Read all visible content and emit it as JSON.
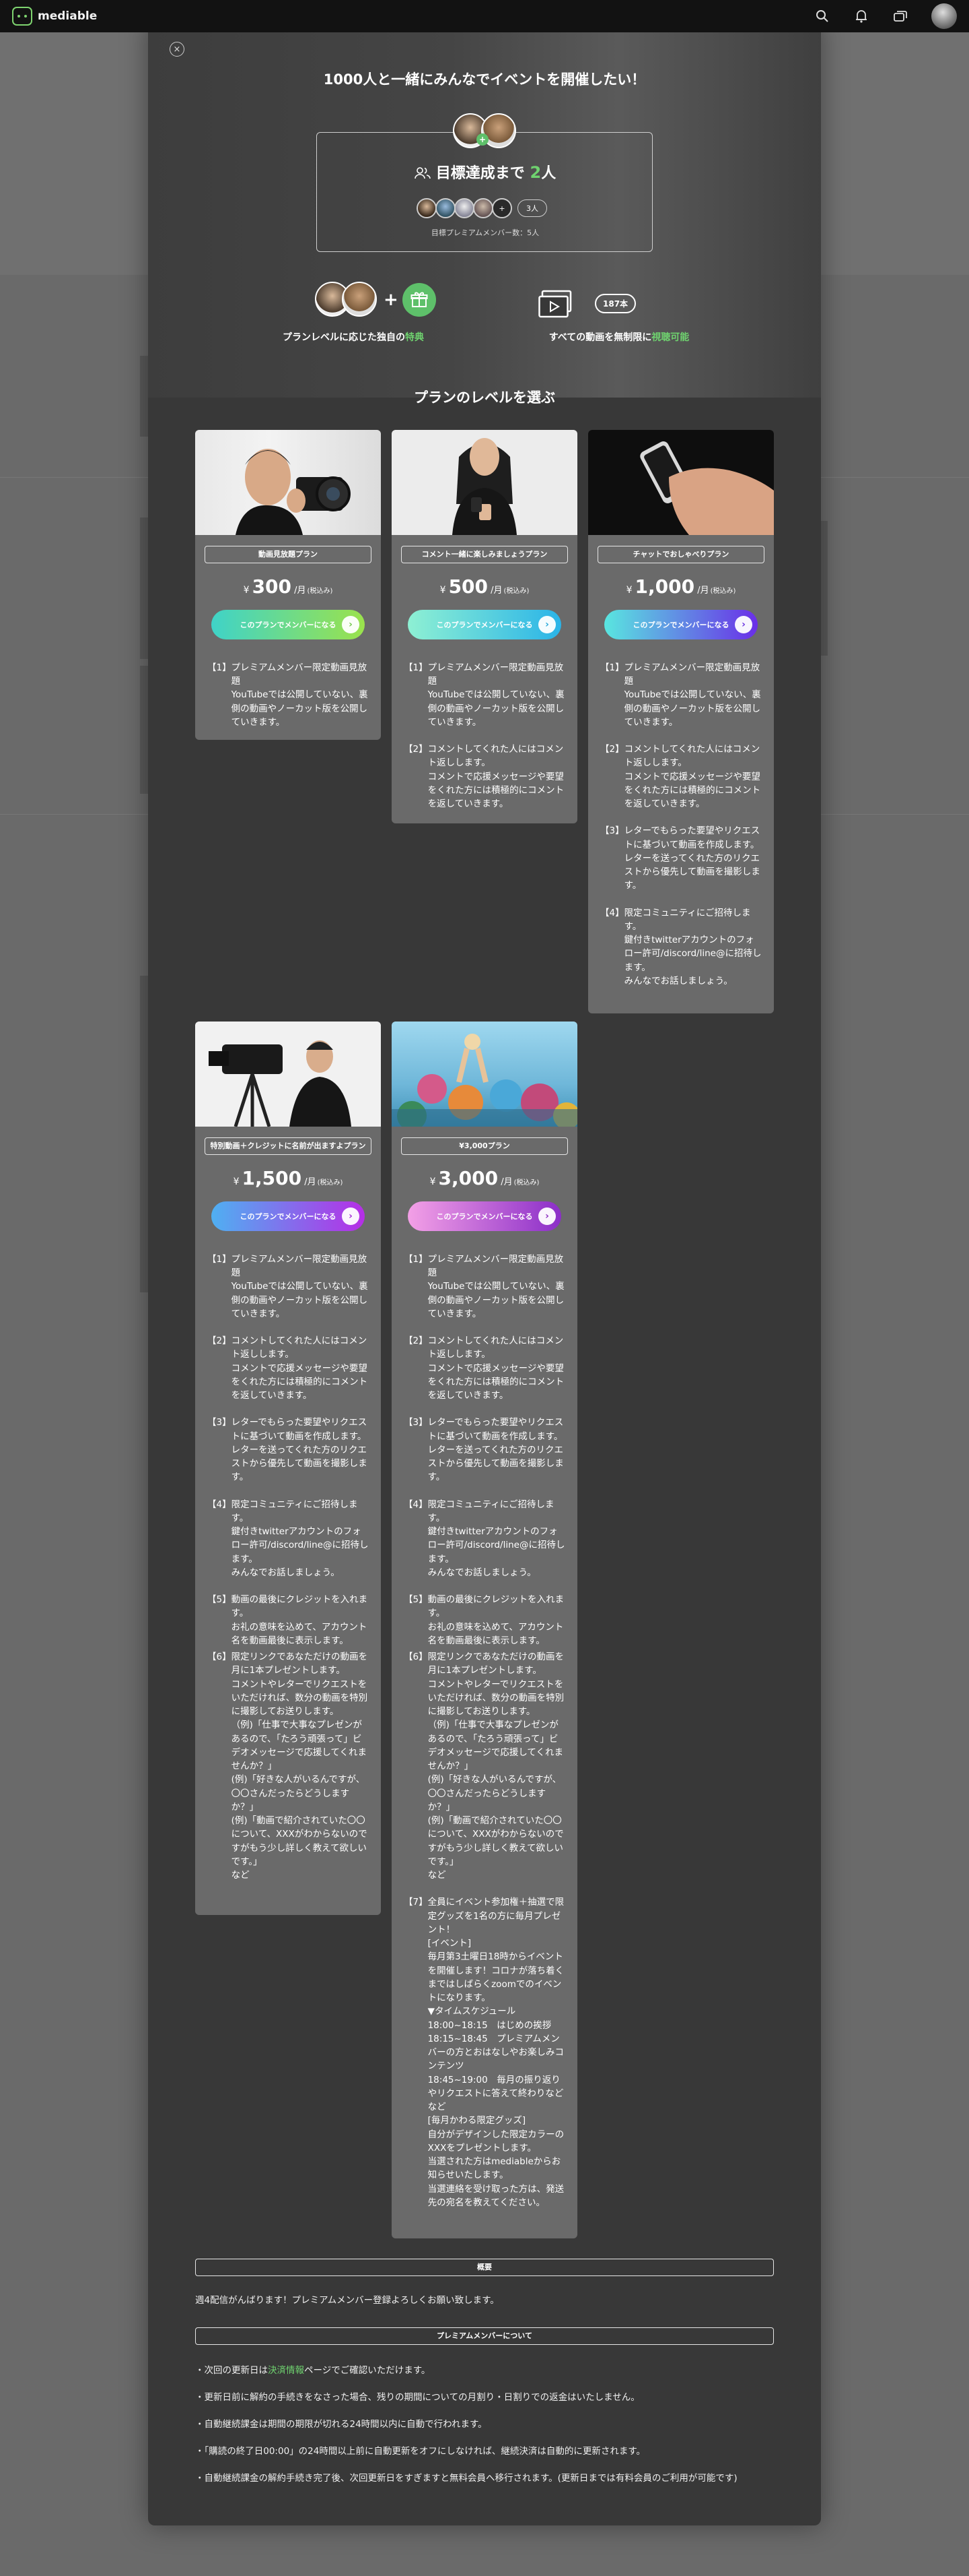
{
  "header": {
    "logo_text": "mediable",
    "icons": [
      "search-icon",
      "bell-icon",
      "cards-icon",
      "avatar"
    ]
  },
  "modal": {
    "close": "×",
    "title": "1000人と一緒にみんなでイベントを開催したい！",
    "goal": {
      "prefix": "目標達成まで",
      "remaining": "2",
      "suffix": "人",
      "member_count_badge": "3人",
      "note": "目標プレミアムメンバー数：5人"
    },
    "benefits": {
      "plan_text_pre": "プランレベルに応じた独自の",
      "plan_text_hl": "特典",
      "video_text_pre": "すべての動画を無制限に",
      "video_text_hl": "視聴可能",
      "video_count": "187本"
    },
    "section_title": "プランのレベルを選ぶ",
    "plans": [
      {
        "name": "動画見放題プラン",
        "currency": "¥",
        "price": "300",
        "unit": "/月",
        "tax": "(税込み)",
        "button": "このプランでメンバーになる",
        "items": [
          {
            "no": "【1】",
            "text": "プレミアムメンバー限定動画見放題\nYouTubeでは公開していない、裏側の動画やノーカット版を公開していきます。"
          }
        ]
      },
      {
        "name": "コメント一緒に楽しみましょうプラン",
        "currency": "¥",
        "price": "500",
        "unit": "/月",
        "tax": "(税込み)",
        "button": "このプランでメンバーになる",
        "items": [
          {
            "no": "【1】",
            "text": "プレミアムメンバー限定動画見放題\nYouTubeでは公開していない、裏側の動画やノーカット版を公開していきます。"
          },
          {
            "no": "【2】",
            "text": "コメントしてくれた人にはコメント返しします。\nコメントで応援メッセージや要望をくれた方には積極的にコメントを返していきます。"
          }
        ]
      },
      {
        "name": "チャットでおしゃべりプラン",
        "currency": "¥",
        "price": "1,000",
        "unit": "/月",
        "tax": "(税込み)",
        "button": "このプランでメンバーになる",
        "items": [
          {
            "no": "【1】",
            "text": "プレミアムメンバー限定動画見放題\nYouTubeでは公開していない、裏側の動画やノーカット版を公開していきます。"
          },
          {
            "no": "【2】",
            "text": "コメントしてくれた人にはコメント返しします。\nコメントで応援メッセージや要望をくれた方には積極的にコメントを返していきます。"
          },
          {
            "no": "【3】",
            "text": "レターでもらった要望やリクエストに基づいて動画を作成します。\nレターを送ってくれた方のリクエストから優先して動画を撮影します。"
          },
          {
            "no": "【4】",
            "text": "限定コミュニティにご招待します。\n鍵付きtwitterアカウントのフォロー許可/discord/line@に招待します。\nみんなでお話しましょう。"
          }
        ]
      },
      {
        "name": "特別動画＋クレジットに名前が出ますよプラン",
        "currency": "¥",
        "price": "1,500",
        "unit": "/月",
        "tax": "(税込み)",
        "button": "このプランでメンバーになる",
        "items": [
          {
            "no": "【1】",
            "text": "プレミアムメンバー限定動画見放題\nYouTubeでは公開していない、裏側の動画やノーカット版を公開していきます。"
          },
          {
            "no": "【2】",
            "text": "コメントしてくれた人にはコメント返しします。\nコメントで応援メッセージや要望をくれた方には積極的にコメントを返していきます。"
          },
          {
            "no": "【3】",
            "text": "レターでもらった要望やリクエストに基づいて動画を作成します。\nレターを送ってくれた方のリクエストから優先して動画を撮影します。"
          },
          {
            "no": "【4】",
            "text": "限定コミュニティにご招待します。\n鍵付きtwitterアカウントのフォロー許可/discord/line@に招待します。\nみんなでお話しましょう。"
          },
          {
            "no": "【5】",
            "text": "動画の最後にクレジットを入れます。\nお礼の意味を込めて、アカウント名を動画最後に表示します。"
          },
          {
            "no": "【6】",
            "text": "限定リンクであなただけの動画を月に1本プレゼントします。\nコメントやレターでリクエストをいただければ、数分の動画を特別に撮影してお送りします。\n（例)「仕事で大事なプレゼンがあるので、「たろう頑張って」ビデオメッセージで応援してくれませんか？」\n(例)「好きな人がいるんですが、〇〇さんだったらどうしますか？」\n(例)「動画で紹介されていた〇〇について、XXXがわからないのですがもう少し詳しく教えて欲しいです。」\nなど"
          }
        ]
      },
      {
        "name": "¥3,000プラン",
        "currency": "¥",
        "price": "3,000",
        "unit": "/月",
        "tax": "(税込み)",
        "button": "このプランでメンバーになる",
        "items": [
          {
            "no": "【1】",
            "text": "プレミアムメンバー限定動画見放題\nYouTubeでは公開していない、裏側の動画やノーカット版を公開していきます。"
          },
          {
            "no": "【2】",
            "text": "コメントしてくれた人にはコメント返しします。\nコメントで応援メッセージや要望をくれた方には積極的にコメントを返していきます。"
          },
          {
            "no": "【3】",
            "text": "レターでもらった要望やリクエストに基づいて動画を作成します。\nレターを送ってくれた方のリクエストから優先して動画を撮影します。"
          },
          {
            "no": "【4】",
            "text": "限定コミュニティにご招待します。\n鍵付きtwitterアカウントのフォロー許可/discord/line@に招待します。\nみんなでお話しましょう。"
          },
          {
            "no": "【5】",
            "text": "動画の最後にクレジットを入れます。\nお礼の意味を込めて、アカウント名を動画最後に表示します。"
          },
          {
            "no": "【6】",
            "text": "限定リンクであなただけの動画を月に1本プレゼントします。\nコメントやレターでリクエストをいただければ、数分の動画を特別に撮影してお送りします。\n（例)「仕事で大事なプレゼンがあるので、「たろう頑張って」ビデオメッセージで応援してくれませんか？」\n(例)「好きな人がいるんですが、〇〇さんだったらどうしますか？」\n(例)「動画で紹介されていた〇〇について、XXXがわからないのですがもう少し詳しく教えて欲しいです。」\nなど"
          },
          {
            "no": "【7】",
            "text": "全員にイベント参加権＋抽選で限定グッズを1名の方に毎月プレゼント！\n[イベント]\n毎月第3土曜日18時からイベントを開催します！コロナが落ち着くまではしばらくzoomでのイベントになります。\n▼タイムスケジュール\n18:00~18:15　はじめの挨拶\n18:15~18:45　プレミアムメンバーの方とおはなしやお楽しみコンテンツ\n18:45~19:00　毎月の振り返りやリクエストに答えて終わりなどなど\n[毎月かわる限定グッズ]\n自分がデザインした限定カラーのXXXをプレゼントします。\n当選された方はmediableからお知らせいたします。\n当選連絡を受け取った方は、発送先の宛名を教えてください。"
          }
        ]
      }
    ],
    "summary": {
      "label": "概要",
      "text": "週4配信がんばります！プレミアムメンバー登録よろしくお願い致します。"
    },
    "about": {
      "label": "プレミアムメンバーについて",
      "line1_pre": "・次回の更新日は",
      "line1_link": "決済情報",
      "line1_post": "ページでご確認いただけます。",
      "line2": "・更新日前に解約の手続きをなさった場合、残りの期間についての月割り・日割りでの返金はいたしません。",
      "line3": "・自動継続課金は期間の期限が切れる24時間以内に自動で行われます。",
      "line4": "・「購読の終了日00:00」の24時間以上前に自動更新をオフにしなければ、継続決済は自動的に更新されます。",
      "line5": "・自動継続課金の解約手続き完了後、次回更新日をすぎますと無料会員へ移行されます。(更新日までは有料会員のご利用が可能です)"
    }
  }
}
